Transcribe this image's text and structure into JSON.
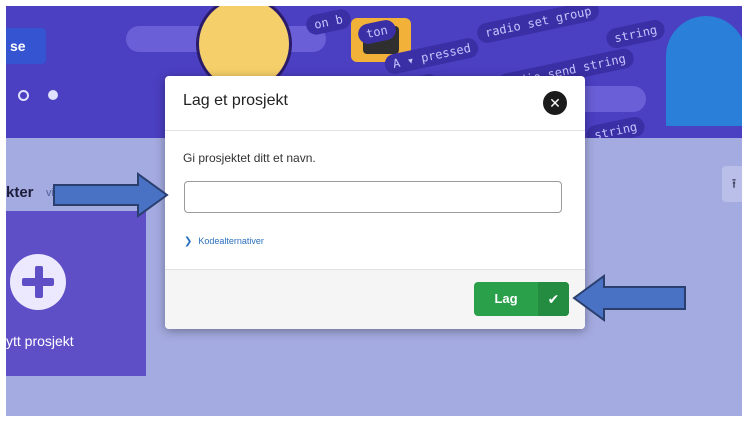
{
  "background": {
    "hero_button_label": "se",
    "hero_code_snippets": [
      "on b",
      "ton",
      "A ▾ pressed",
      "radio set group",
      "string",
      "radio send string",
      "ing",
      "string"
    ],
    "section_title": "kter",
    "section_link": "vis all",
    "new_project_label": "ytt prosjekt",
    "upload_icon": "upload-icon"
  },
  "dialog": {
    "title": "Lag et prosjekt",
    "close_icon": "close-icon",
    "name_label": "Gi prosjektet ditt et navn.",
    "name_value": "",
    "name_placeholder": "",
    "code_options_label": "Kodealternativer",
    "create_label": "Lag",
    "create_icon": "checkmark-icon"
  },
  "colors": {
    "accent_green": "#2aa04a",
    "overlay_blue": "#a4abe0",
    "arrow_fill": "#4a72c4",
    "arrow_stroke": "#2a3f6e"
  }
}
